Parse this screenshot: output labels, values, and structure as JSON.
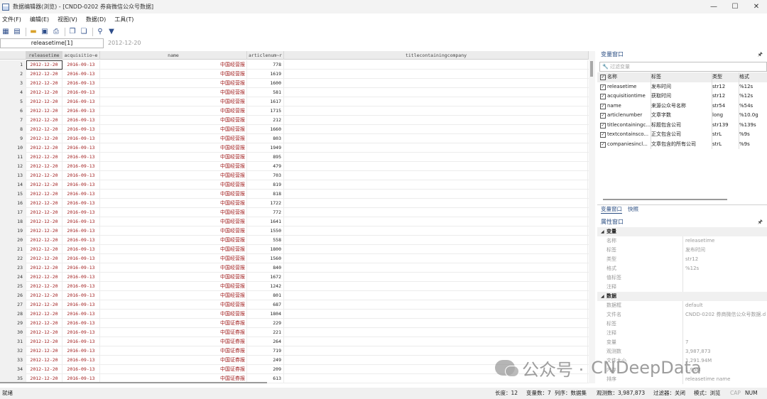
{
  "window": {
    "title": "数据编辑器(浏览) - [CNDD-0202 券商微信公众号数据]",
    "controls": [
      "—",
      "☐",
      "✕"
    ]
  },
  "menu": [
    "文件(F)",
    "编辑(E)",
    "视图(V)",
    "数据(D)",
    "工具(T)"
  ],
  "formula": {
    "var_ref": "releasetime[1]",
    "value": "2012-12-20"
  },
  "grid": {
    "headers": [
      "releasetime",
      "acquisitio~e",
      "name",
      "articlenum~r",
      "titlecontainingcompany"
    ],
    "rows": [
      {
        "n": "1",
        "rel": "2012-12-20",
        "acq": "2016-09-13",
        "name": "中国经营报",
        "art": "778"
      },
      {
        "n": "2",
        "rel": "2012-12-20",
        "acq": "2016-09-13",
        "name": "中国经营报",
        "art": "1619"
      },
      {
        "n": "3",
        "rel": "2012-12-20",
        "acq": "2016-09-13",
        "name": "中国经营报",
        "art": "1600"
      },
      {
        "n": "4",
        "rel": "2012-12-20",
        "acq": "2016-09-13",
        "name": "中国经营报",
        "art": "581"
      },
      {
        "n": "5",
        "rel": "2012-12-20",
        "acq": "2016-09-13",
        "name": "中国经营报",
        "art": "1617"
      },
      {
        "n": "6",
        "rel": "2012-12-20",
        "acq": "2016-09-13",
        "name": "中国经营报",
        "art": "1715"
      },
      {
        "n": "7",
        "rel": "2012-12-20",
        "acq": "2016-09-13",
        "name": "中国经营报",
        "art": "212"
      },
      {
        "n": "8",
        "rel": "2012-12-20",
        "acq": "2016-09-13",
        "name": "中国经营报",
        "art": "1660"
      },
      {
        "n": "9",
        "rel": "2012-12-20",
        "acq": "2016-09-13",
        "name": "中国经营报",
        "art": "803"
      },
      {
        "n": "10",
        "rel": "2012-12-20",
        "acq": "2016-09-13",
        "name": "中国经营报",
        "art": "1949"
      },
      {
        "n": "11",
        "rel": "2012-12-20",
        "acq": "2016-09-13",
        "name": "中国经营报",
        "art": "895"
      },
      {
        "n": "12",
        "rel": "2012-12-20",
        "acq": "2016-09-13",
        "name": "中国经营报",
        "art": "479"
      },
      {
        "n": "13",
        "rel": "2012-12-20",
        "acq": "2016-09-13",
        "name": "中国经营报",
        "art": "703"
      },
      {
        "n": "14",
        "rel": "2012-12-20",
        "acq": "2016-09-13",
        "name": "中国经营报",
        "art": "819"
      },
      {
        "n": "15",
        "rel": "2012-12-20",
        "acq": "2016-09-13",
        "name": "中国经营报",
        "art": "818"
      },
      {
        "n": "16",
        "rel": "2012-12-20",
        "acq": "2016-09-13",
        "name": "中国经营报",
        "art": "1722"
      },
      {
        "n": "17",
        "rel": "2012-12-20",
        "acq": "2016-09-13",
        "name": "中国经营报",
        "art": "772"
      },
      {
        "n": "18",
        "rel": "2012-12-20",
        "acq": "2016-09-13",
        "name": "中国经营报",
        "art": "1641"
      },
      {
        "n": "19",
        "rel": "2012-12-20",
        "acq": "2016-09-13",
        "name": "中国经营报",
        "art": "1550"
      },
      {
        "n": "20",
        "rel": "2012-12-20",
        "acq": "2016-09-13",
        "name": "中国经营报",
        "art": "558"
      },
      {
        "n": "21",
        "rel": "2012-12-20",
        "acq": "2016-09-13",
        "name": "中国经营报",
        "art": "1800"
      },
      {
        "n": "22",
        "rel": "2012-12-20",
        "acq": "2016-09-13",
        "name": "中国经营报",
        "art": "1560"
      },
      {
        "n": "23",
        "rel": "2012-12-20",
        "acq": "2016-09-13",
        "name": "中国经营报",
        "art": "840"
      },
      {
        "n": "24",
        "rel": "2012-12-20",
        "acq": "2016-09-13",
        "name": "中国经营报",
        "art": "1672"
      },
      {
        "n": "25",
        "rel": "2012-12-20",
        "acq": "2016-09-13",
        "name": "中国经营报",
        "art": "1242"
      },
      {
        "n": "26",
        "rel": "2012-12-20",
        "acq": "2016-09-13",
        "name": "中国经营报",
        "art": "801"
      },
      {
        "n": "27",
        "rel": "2012-12-20",
        "acq": "2016-09-13",
        "name": "中国经营报",
        "art": "687"
      },
      {
        "n": "28",
        "rel": "2012-12-20",
        "acq": "2016-09-13",
        "name": "中国经营报",
        "art": "1804"
      },
      {
        "n": "29",
        "rel": "2012-12-20",
        "acq": "2016-09-13",
        "name": "中国证券报",
        "art": "229"
      },
      {
        "n": "30",
        "rel": "2012-12-20",
        "acq": "2016-09-13",
        "name": "中国证券报",
        "art": "221"
      },
      {
        "n": "31",
        "rel": "2012-12-20",
        "acq": "2016-09-13",
        "name": "中国证券报",
        "art": "264"
      },
      {
        "n": "32",
        "rel": "2012-12-20",
        "acq": "2016-09-13",
        "name": "中国证券报",
        "art": "719"
      },
      {
        "n": "33",
        "rel": "2012-12-20",
        "acq": "2016-09-13",
        "name": "中国证券报",
        "art": "249"
      },
      {
        "n": "34",
        "rel": "2012-12-20",
        "acq": "2016-09-13",
        "name": "中国证券报",
        "art": "209"
      },
      {
        "n": "35",
        "rel": "2012-12-20",
        "acq": "2016-09-13",
        "name": "中国证券报",
        "art": "613"
      }
    ]
  },
  "variables": {
    "title": "变量窗口",
    "filter_placeholder": "过滤变量",
    "headers": [
      "名称",
      "标签",
      "类型",
      "格式"
    ],
    "rows": [
      {
        "name": "releasetime",
        "label": "发布时间",
        "type": "str12",
        "fmt": "%12s"
      },
      {
        "name": "acquisitiontime",
        "label": "获取时间",
        "type": "str12",
        "fmt": "%12s"
      },
      {
        "name": "name",
        "label": "来源公众号名称",
        "type": "str54",
        "fmt": "%54s"
      },
      {
        "name": "articlenumber",
        "label": "文章字数",
        "type": "long",
        "fmt": "%10.0g"
      },
      {
        "name": "titlecontainingc...",
        "label": "标题包含公司",
        "type": "str139",
        "fmt": "%139s"
      },
      {
        "name": "textcontainsco...",
        "label": "正文包含公司",
        "type": "strL",
        "fmt": "%9s"
      },
      {
        "name": "companiesincl...",
        "label": "文章包含的所有公司",
        "type": "strL",
        "fmt": "%9s"
      }
    ],
    "tabs": [
      "变量窗口",
      "快照"
    ]
  },
  "properties": {
    "title": "属性窗口",
    "sections": [
      {
        "name": "变量",
        "rows": [
          {
            "k": "名称",
            "v": "releasetime"
          },
          {
            "k": "标签",
            "v": "发布时间"
          },
          {
            "k": "类型",
            "v": "str12"
          },
          {
            "k": "格式",
            "v": "%12s"
          },
          {
            "k": "值标签",
            "v": ""
          },
          {
            "k": "注释",
            "v": ""
          }
        ]
      },
      {
        "name": "数据",
        "rows": [
          {
            "k": "数据框",
            "v": "default"
          },
          {
            "k": "文件名",
            "v": "CNDD-0202 券商微信公众号数据.d"
          },
          {
            "k": "标签",
            "v": ""
          },
          {
            "k": "注释",
            "v": ""
          },
          {
            "k": "变量",
            "v": "7"
          },
          {
            "k": "观测数",
            "v": "3,987,873"
          },
          {
            "k": "文件大小",
            "v": "1,291.94M"
          },
          {
            "k": "内存",
            "v": "1.95M"
          },
          {
            "k": "排序",
            "v": "releasetime name"
          }
        ]
      }
    ]
  },
  "status": {
    "ready": "就绪",
    "length": "长度：12",
    "vars": "变量数：7",
    "order": "列序：数据集",
    "obs": "观测数：3,987,873",
    "filter": "过滤器：关闭",
    "mode": "模式：浏览",
    "cap": "CAP",
    "num": "NUM"
  },
  "watermark": {
    "text1": "公众号 ·",
    "text2": "CNDeepData"
  }
}
